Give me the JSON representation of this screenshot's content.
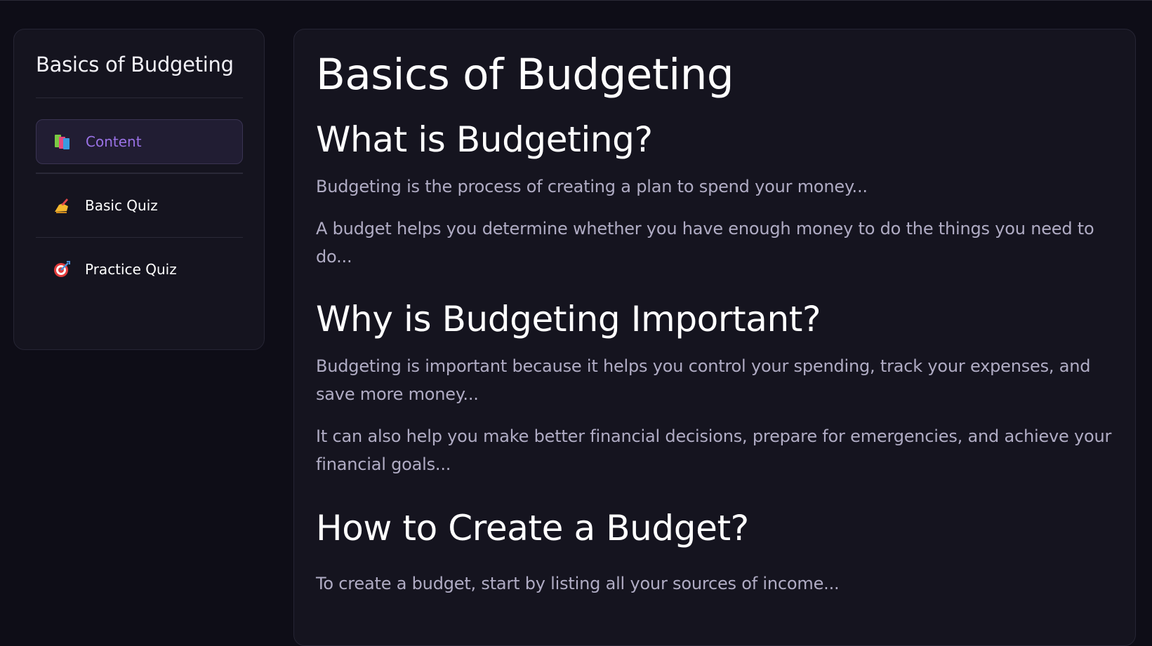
{
  "sidebar": {
    "title": "Basics of Budgeting",
    "items": [
      {
        "label": "Content",
        "icon": "books-icon",
        "active": true
      },
      {
        "label": "Basic Quiz",
        "icon": "writing-hand-icon",
        "active": false
      },
      {
        "label": "Practice Quiz",
        "icon": "target-icon",
        "active": false
      }
    ]
  },
  "main": {
    "title": "Basics of Budgeting",
    "sections": [
      {
        "heading": "What is Budgeting?",
        "paragraphs": [
          "Budgeting is the process of creating a plan to spend your money...",
          "A budget helps you determine whether you have enough money to do the things you need to do..."
        ]
      },
      {
        "heading": "Why is Budgeting Important?",
        "paragraphs": [
          "Budgeting is important because it helps you control your spending, track your expenses, and save more money...",
          "It can also help you make better financial decisions, prepare for emergencies, and achieve your financial goals..."
        ]
      },
      {
        "heading": "How to Create a Budget?",
        "paragraphs": [
          "To create a budget, start by listing all your sources of income..."
        ]
      }
    ]
  },
  "colors": {
    "background": "#0e0d17",
    "panel": "#15141f",
    "accent": "#9a72e6",
    "body_text": "#b0acc4"
  }
}
